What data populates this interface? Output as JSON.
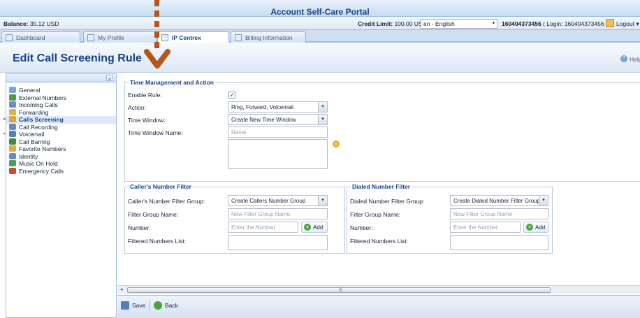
{
  "header": {
    "title": "Account Self-Care Portal",
    "balance_label": "Balance:",
    "balance_value": "35.12 USD",
    "credit_label": "Credit Limit:",
    "credit_value": "100.00 USD",
    "language": "en - English",
    "account_id": "160404373456",
    "login_text": "( Login: 160404373456 )",
    "logout_label": "Logout"
  },
  "tabs": [
    {
      "label": "Dashboard",
      "active": false
    },
    {
      "label": "My Profile",
      "active": false
    },
    {
      "label": "IP Centrex",
      "active": true
    },
    {
      "label": "Billing Information",
      "active": false
    }
  ],
  "page": {
    "title": "Edit Call Screening Rule",
    "help_label": "Help"
  },
  "sidebar": {
    "collapse_icon": "«",
    "items": [
      {
        "label": "General",
        "icon": "gear-icon",
        "color": "#7fa6cf"
      },
      {
        "label": "External Numbers",
        "icon": "globe-phone-icon",
        "color": "#4f9a4a"
      },
      {
        "label": "Incoming Calls",
        "icon": "people-icon",
        "color": "#6d8fc6"
      },
      {
        "label": "Forwarding",
        "icon": "forward-icon",
        "color": "#d9b443"
      },
      {
        "label": "Calls Screening",
        "icon": "screening-icon",
        "color": "#e3a23a",
        "selected": true
      },
      {
        "label": "Call Recording",
        "icon": "recording-icon",
        "color": "#6e89b9"
      },
      {
        "label": "Voicemail",
        "icon": "voicemail-icon",
        "color": "#5d7fb8"
      },
      {
        "label": "Call Barring",
        "icon": "barring-icon",
        "color": "#3f8d3a"
      },
      {
        "label": "Favorite Numbers",
        "icon": "favorite-icon",
        "color": "#e2ab36"
      },
      {
        "label": "Identity",
        "icon": "identity-icon",
        "color": "#6a8cc4"
      },
      {
        "label": "Music On Hold",
        "icon": "music-icon",
        "color": "#4e9a57"
      },
      {
        "label": "Emergency Calls",
        "icon": "emergency-icon",
        "color": "#d24a2c"
      }
    ]
  },
  "time_section": {
    "legend": "Time Management and Action",
    "enable_rule_label": "Enable Rule:",
    "enable_rule_checked": "✓",
    "action_label": "Action:",
    "action_value": "Ring, Forward, Voicemail",
    "time_window_label": "Time Window:",
    "time_window_value": "Create New Time Window",
    "time_window_name_label": "Time Window Name:",
    "time_window_name_placeholder": "Name"
  },
  "callers_filter": {
    "legend": "Caller's Number Filter",
    "group_label": "Caller's Number Filter Group:",
    "group_value": "Create Callers Number Group",
    "name_label": "Filter Group Name:",
    "name_placeholder": "New Filter Group Name",
    "number_label": "Number:",
    "number_placeholder": "Enter the Number",
    "add_label": "Add",
    "list_label": "Filtered Numbers List:"
  },
  "dialed_filter": {
    "legend": "Dialed Number Filter",
    "group_label": "Dialed Number Filter Group:",
    "group_value": "Create Dialed Number Filter Group",
    "name_label": "Filter Group Name:",
    "name_placeholder": "New Filter Group Name",
    "number_label": "Number:",
    "number_placeholder": "Enter the Number",
    "add_label": "Add",
    "list_label": "Filtered Numbers List:"
  },
  "toolbar": {
    "save_label": "Save",
    "back_label": "Back"
  },
  "colors": {
    "accent": "#15428b",
    "annotation_arrow": "#b5561c"
  }
}
